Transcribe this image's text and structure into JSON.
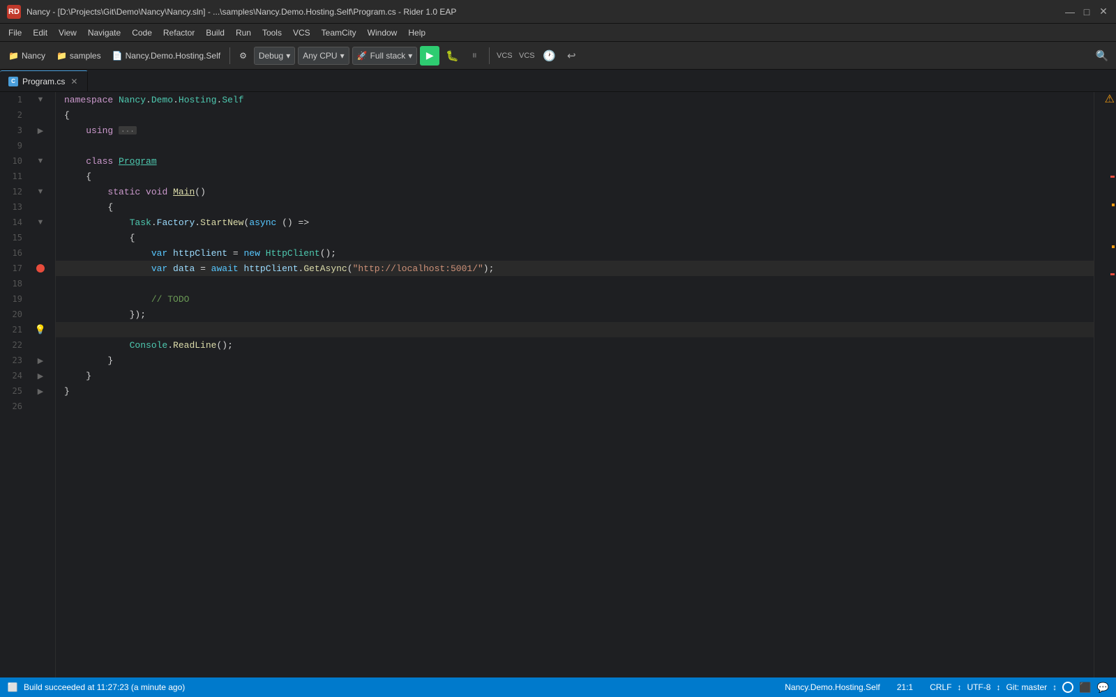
{
  "title_bar": {
    "app_icon": "RD",
    "title": "Nancy - [D:\\Projects\\Git\\Demo\\Nancy\\Nancy.sln] - ...\\samples\\Nancy.Demo.Hosting.Self\\Program.cs - Rider 1.0 EAP",
    "minimize": "—",
    "maximize": "□",
    "close": "✕"
  },
  "menu": {
    "items": [
      "File",
      "Edit",
      "View",
      "Navigate",
      "Code",
      "Refactor",
      "Build",
      "Run",
      "Tools",
      "VCS",
      "TeamCity",
      "Window",
      "Help"
    ]
  },
  "toolbar": {
    "nav1_icon": "📁",
    "nav1_label": "Nancy",
    "nav2_icon": "📁",
    "nav2_label": "samples",
    "nav3_icon": "📄",
    "nav3_label": "Nancy.Demo.Hosting.Self",
    "config_icon": "⚙",
    "config_label": "Debug",
    "platform_label": "Any CPU",
    "run_config_label": "Full stack",
    "play_icon": "▶",
    "debug_icon": "🐛",
    "pause_icon": "⏸",
    "vcs1": "VCS",
    "vcs2": "VCS",
    "clock_icon": "🕐",
    "undo_icon": "↩",
    "search_icon": "🔍"
  },
  "tabs": [
    {
      "label": "Program.cs",
      "active": true,
      "closeable": true
    }
  ],
  "code": {
    "lines": [
      {
        "num": 1,
        "gutter": "fold",
        "content": "namespace_line",
        "text": "namespace Nancy.Demo.Hosting.Self"
      },
      {
        "num": 2,
        "gutter": "",
        "content": "brace_open",
        "text": "{"
      },
      {
        "num": 3,
        "gutter": "fold",
        "content": "using_line",
        "text": "    using ..."
      },
      {
        "num": 9,
        "gutter": "",
        "content": "empty",
        "text": ""
      },
      {
        "num": 10,
        "gutter": "fold",
        "content": "class_line",
        "text": "    class Program"
      },
      {
        "num": 11,
        "gutter": "",
        "content": "brace_open2",
        "text": "    {"
      },
      {
        "num": 12,
        "gutter": "fold",
        "content": "method_line",
        "text": "        static void Main()"
      },
      {
        "num": 13,
        "gutter": "",
        "content": "brace_open3",
        "text": "        {"
      },
      {
        "num": 14,
        "gutter": "fold",
        "content": "task_line",
        "text": "            Task.Factory.StartNew(async () =>"
      },
      {
        "num": 15,
        "gutter": "",
        "content": "brace_open4",
        "text": "            {"
      },
      {
        "num": 16,
        "gutter": "",
        "content": "var_line",
        "text": "                var httpClient = new HttpClient();"
      },
      {
        "num": 17,
        "gutter": "bp",
        "content": "data_line",
        "text": "                var data = await httpClient.GetAsync(\"http://localhost:5001/\");"
      },
      {
        "num": 18,
        "gutter": "",
        "content": "empty2",
        "text": ""
      },
      {
        "num": 19,
        "gutter": "",
        "content": "todo_line",
        "text": "                // TODO"
      },
      {
        "num": 20,
        "gutter": "",
        "content": "close_task",
        "text": "            });"
      },
      {
        "num": 21,
        "gutter": "bulb",
        "content": "empty3",
        "text": ""
      },
      {
        "num": 22,
        "gutter": "",
        "content": "console_line",
        "text": "            Console.ReadLine();"
      },
      {
        "num": 23,
        "gutter": "",
        "content": "brace_close3",
        "text": "        }"
      },
      {
        "num": 24,
        "gutter": "",
        "content": "brace_close2",
        "text": "    }"
      },
      {
        "num": 25,
        "gutter": "",
        "content": "brace_close1",
        "text": "}"
      },
      {
        "num": 26,
        "gutter": "",
        "content": "empty4",
        "text": ""
      }
    ]
  },
  "status": {
    "build_status": "Build succeeded at 11:27:23 (a minute ago)",
    "project": "Nancy.Demo.Hosting.Self",
    "position": "21:1",
    "line_ending": "CRLF",
    "encoding": "UTF-8",
    "vcs": "Git: master"
  }
}
